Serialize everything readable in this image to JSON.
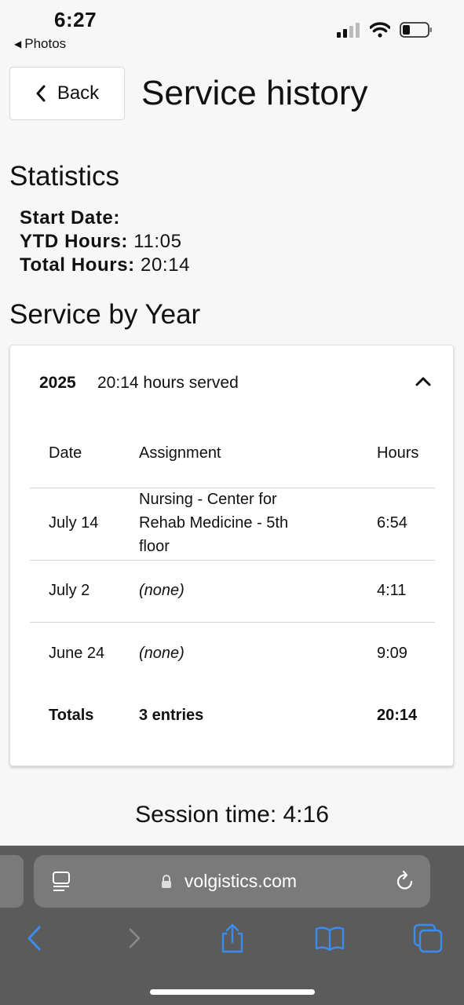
{
  "status_bar": {
    "time": "6:27",
    "back_app": "Photos"
  },
  "header": {
    "back_label": "Back",
    "title": "Service history"
  },
  "statistics": {
    "heading": "Statistics",
    "start_date_label": "Start Date:",
    "start_date_value": "",
    "ytd_label": "YTD Hours:",
    "ytd_value": "11:05",
    "total_label": "Total Hours:",
    "total_value": "20:14"
  },
  "service_by_year": {
    "heading": "Service by Year",
    "year": "2025",
    "summary": "20:14 hours served",
    "columns": [
      "Date",
      "Assignment",
      "Hours"
    ],
    "rows": [
      {
        "date": "July 14",
        "assignment": "Nursing - Center for Rehab Medicine - 5th floor",
        "hours": "6:54"
      },
      {
        "date": "July 2",
        "assignment": "(none)",
        "hours": "4:11"
      },
      {
        "date": "June 24",
        "assignment": "(none)",
        "hours": "9:09"
      }
    ],
    "totals": {
      "label": "Totals",
      "entries": "3 entries",
      "hours": "20:14"
    }
  },
  "session": {
    "text": "Session time: 4:16"
  },
  "browser": {
    "url": "volgistics.com",
    "accent_color": "#3b8cf0",
    "icons": [
      "reader-icon",
      "lock-icon",
      "reload-icon",
      "back-arrow-icon",
      "forward-arrow-icon",
      "share-icon",
      "bookmarks-icon",
      "tabs-icon"
    ]
  }
}
